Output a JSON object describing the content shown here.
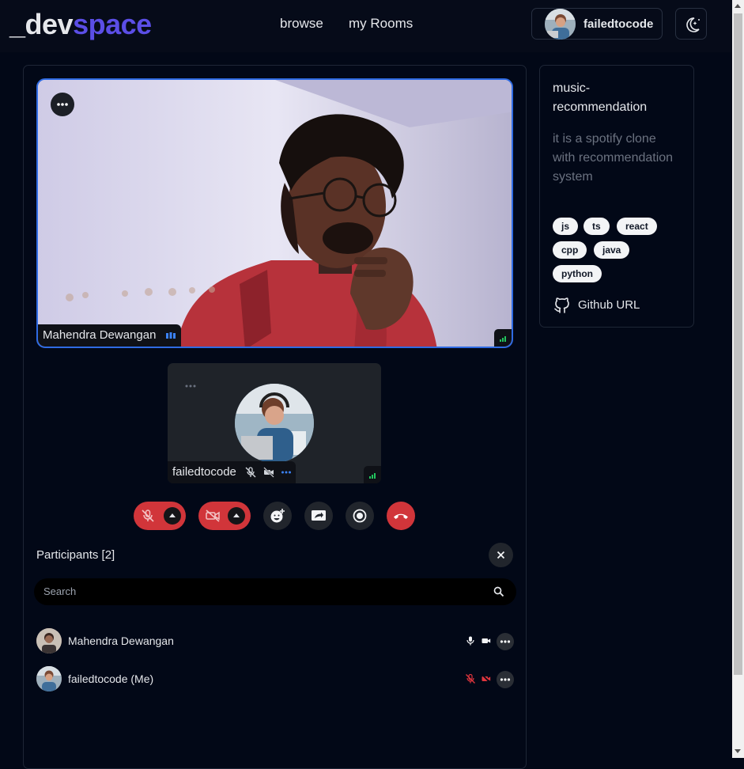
{
  "header": {
    "logo_prefix": "_dev",
    "logo_suffix": "space",
    "nav_browse": "browse",
    "nav_rooms": "my Rooms",
    "username": "failedtocode",
    "theme_icon": "moon-stars-icon"
  },
  "room": {
    "title": "music-recommendation",
    "description": "it is a spotify clone with recommendation system",
    "tags": [
      "js",
      "ts",
      "react",
      "cpp",
      "java",
      "python"
    ],
    "github_label": "Github URL"
  },
  "call": {
    "main_participant_name": "Mahendra Dewangan",
    "self_name": "failedtocode",
    "mic_muted": true,
    "camera_off": true
  },
  "participants": {
    "title": "Participants [2]",
    "search_placeholder": "Search",
    "list": [
      {
        "name": "Mahendra Dewangan",
        "mic": "on",
        "camera": "on"
      },
      {
        "name": "failedtocode (Me)",
        "mic": "muted",
        "camera": "off"
      }
    ]
  },
  "colors": {
    "background": "#020817",
    "accent": "#5b4ee6",
    "active_border": "#2f6be3",
    "danger": "#d1353a"
  }
}
